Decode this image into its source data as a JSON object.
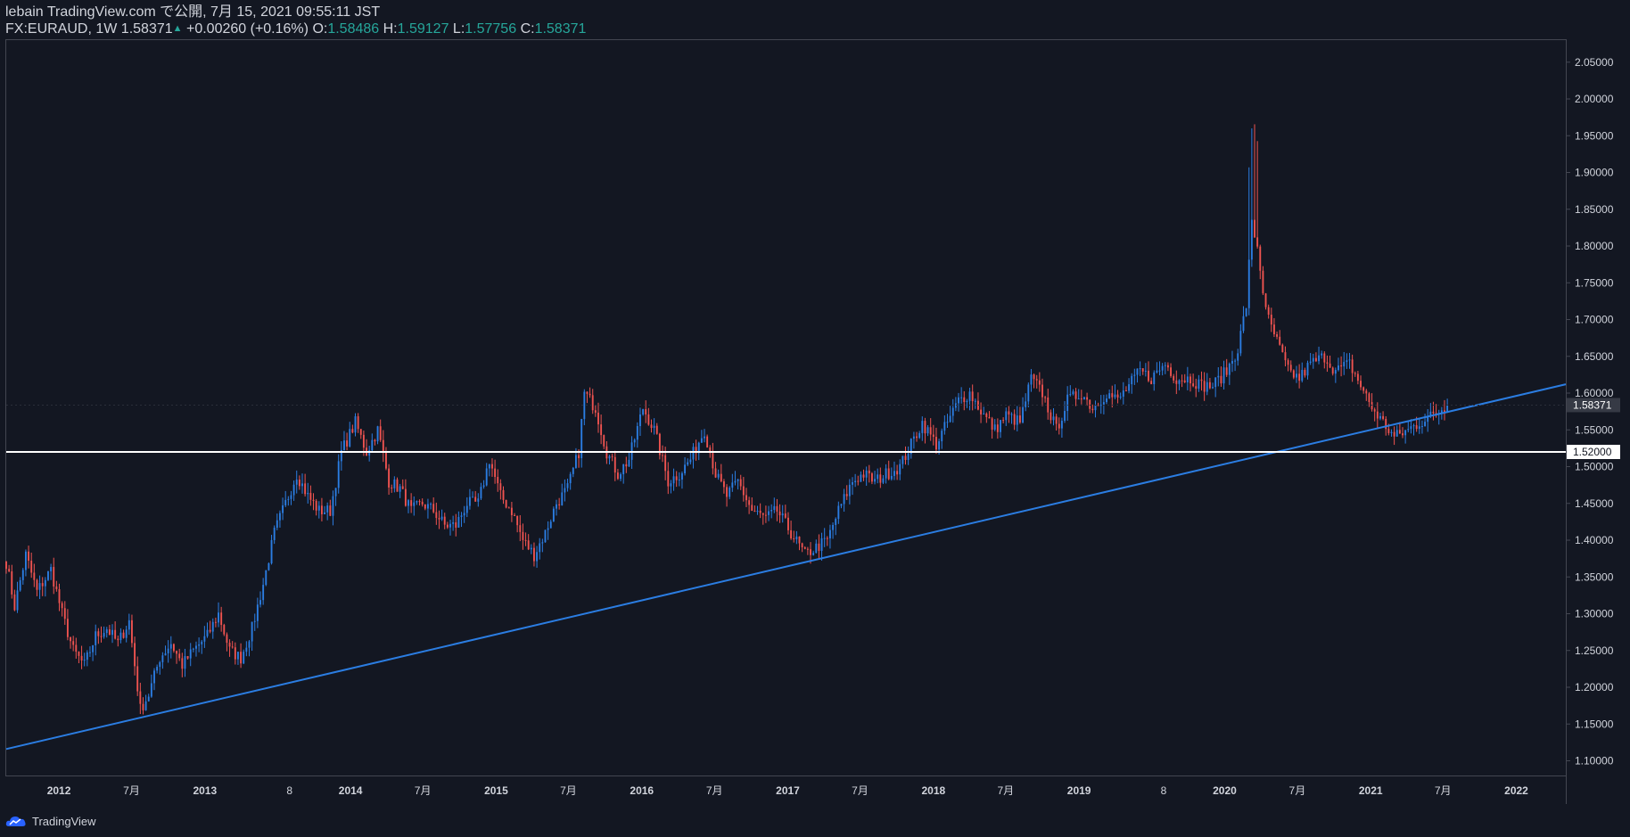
{
  "header": {
    "publish_line": "lebain TradingView.com で公開, 7月 15, 2021 09:55:11 JST",
    "symbol": "FX:EURAUD, 1W",
    "last": "1.58371",
    "change": "+0.00260 (+0.16%)",
    "open_label": "O:",
    "open": "1.58486",
    "high_label": "H:",
    "high": "1.59127",
    "low_label": "L:",
    "low": "1.57756",
    "close_label": "C:",
    "close": "1.58371"
  },
  "footer": {
    "brand": "TradingView",
    "icon": "tradingview-cloud-icon"
  },
  "colors": {
    "background": "#131722",
    "up": "#2b7de2",
    "down": "#ef5350",
    "trendline": "#2b7de2",
    "hline": "#ffffff",
    "axis_text": "#d1d4dc"
  },
  "chart_data": {
    "type": "candlestick",
    "ylim": [
      1.08,
      2.08
    ],
    "y_ticks": [
      "2.05000",
      "2.00000",
      "1.95000",
      "1.90000",
      "1.85000",
      "1.80000",
      "1.75000",
      "1.70000",
      "1.65000",
      "1.60000",
      "1.55000",
      "1.50000",
      "1.45000",
      "1.40000",
      "1.35000",
      "1.30000",
      "1.25000",
      "1.20000",
      "1.15000",
      "1.10000"
    ],
    "x_range": [
      "2011-08-22",
      "2022-05-05"
    ],
    "x_ticks": [
      {
        "label": "2012",
        "date": "2012-01-01"
      },
      {
        "label": "7月",
        "date": "2012-07-01"
      },
      {
        "label": "2013",
        "date": "2013-01-01"
      },
      {
        "label": "8",
        "date": "2013-08-01"
      },
      {
        "label": "2014",
        "date": "2014-01-01"
      },
      {
        "label": "7月",
        "date": "2014-07-01"
      },
      {
        "label": "2015",
        "date": "2015-01-01"
      },
      {
        "label": "7月",
        "date": "2015-07-01"
      },
      {
        "label": "2016",
        "date": "2016-01-01"
      },
      {
        "label": "7月",
        "date": "2016-07-01"
      },
      {
        "label": "2017",
        "date": "2017-01-01"
      },
      {
        "label": "7月",
        "date": "2017-07-01"
      },
      {
        "label": "2018",
        "date": "2018-01-01"
      },
      {
        "label": "7月",
        "date": "2018-07-01"
      },
      {
        "label": "2019",
        "date": "2019-01-01"
      },
      {
        "label": "8",
        "date": "2019-08-01"
      },
      {
        "label": "2020",
        "date": "2020-01-01"
      },
      {
        "label": "7月",
        "date": "2020-07-01"
      },
      {
        "label": "2021",
        "date": "2021-01-01"
      },
      {
        "label": "7月",
        "date": "2021-07-01"
      },
      {
        "label": "2022",
        "date": "2022-01-01"
      }
    ],
    "price_path": [
      [
        "2011-08-22",
        1.37
      ],
      [
        "2011-09-12",
        1.31
      ],
      [
        "2011-10-10",
        1.38
      ],
      [
        "2011-11-07",
        1.33
      ],
      [
        "2011-12-12",
        1.36
      ],
      [
        "2012-01-09",
        1.3
      ],
      [
        "2012-02-06",
        1.25
      ],
      [
        "2012-03-05",
        1.23
      ],
      [
        "2012-04-02",
        1.27
      ],
      [
        "2012-04-30",
        1.28
      ],
      [
        "2012-05-28",
        1.26
      ],
      [
        "2012-06-25",
        1.29
      ],
      [
        "2012-07-23",
        1.17
      ],
      [
        "2012-08-13",
        1.19
      ],
      [
        "2012-09-10",
        1.24
      ],
      [
        "2012-10-08",
        1.26
      ],
      [
        "2012-11-05",
        1.23
      ],
      [
        "2012-12-03",
        1.25
      ],
      [
        "2013-01-07",
        1.27
      ],
      [
        "2013-02-04",
        1.3
      ],
      [
        "2013-03-04",
        1.25
      ],
      [
        "2013-04-01",
        1.24
      ],
      [
        "2013-04-29",
        1.28
      ],
      [
        "2013-05-27",
        1.34
      ],
      [
        "2013-06-24",
        1.41
      ],
      [
        "2013-07-22",
        1.45
      ],
      [
        "2013-08-19",
        1.49
      ],
      [
        "2013-09-16",
        1.46
      ],
      [
        "2013-10-14",
        1.44
      ],
      [
        "2013-11-11",
        1.44
      ],
      [
        "2013-12-09",
        1.52
      ],
      [
        "2014-01-13",
        1.56
      ],
      [
        "2014-02-10",
        1.52
      ],
      [
        "2014-03-10",
        1.55
      ],
      [
        "2014-04-07",
        1.48
      ],
      [
        "2014-05-05",
        1.47
      ],
      [
        "2014-06-02",
        1.44
      ],
      [
        "2014-06-30",
        1.45
      ],
      [
        "2014-07-28",
        1.44
      ],
      [
        "2014-08-25",
        1.42
      ],
      [
        "2014-09-22",
        1.42
      ],
      [
        "2014-10-20",
        1.45
      ],
      [
        "2014-11-17",
        1.45
      ],
      [
        "2014-12-15",
        1.51
      ],
      [
        "2015-01-12",
        1.46
      ],
      [
        "2015-02-09",
        1.44
      ],
      [
        "2015-03-09",
        1.4
      ],
      [
        "2015-04-06",
        1.38
      ],
      [
        "2015-05-04",
        1.41
      ],
      [
        "2015-06-01",
        1.45
      ],
      [
        "2015-06-29",
        1.47
      ],
      [
        "2015-07-27",
        1.52
      ],
      [
        "2015-08-10",
        1.6
      ],
      [
        "2015-09-07",
        1.58
      ],
      [
        "2015-10-05",
        1.52
      ],
      [
        "2015-11-02",
        1.49
      ],
      [
        "2015-11-30",
        1.51
      ],
      [
        "2016-01-04",
        1.58
      ],
      [
        "2016-02-01",
        1.55
      ],
      [
        "2016-03-07",
        1.48
      ],
      [
        "2016-04-04",
        1.49
      ],
      [
        "2016-05-02",
        1.51
      ],
      [
        "2016-06-06",
        1.55
      ],
      [
        "2016-07-04",
        1.49
      ],
      [
        "2016-08-01",
        1.46
      ],
      [
        "2016-08-29",
        1.48
      ],
      [
        "2016-10-03",
        1.44
      ],
      [
        "2016-11-07",
        1.43
      ],
      [
        "2016-12-05",
        1.44
      ],
      [
        "2017-01-09",
        1.41
      ],
      [
        "2017-02-13",
        1.38
      ],
      [
        "2017-03-13",
        1.39
      ],
      [
        "2017-04-10",
        1.4
      ],
      [
        "2017-05-08",
        1.44
      ],
      [
        "2017-06-12",
        1.48
      ],
      [
        "2017-07-10",
        1.49
      ],
      [
        "2017-08-07",
        1.48
      ],
      [
        "2017-09-04",
        1.49
      ],
      [
        "2017-10-09",
        1.5
      ],
      [
        "2017-11-06",
        1.53
      ],
      [
        "2017-12-04",
        1.56
      ],
      [
        "2018-01-08",
        1.53
      ],
      [
        "2018-02-05",
        1.56
      ],
      [
        "2018-03-05",
        1.59
      ],
      [
        "2018-04-02",
        1.6
      ],
      [
        "2018-05-07",
        1.57
      ],
      [
        "2018-06-04",
        1.55
      ],
      [
        "2018-07-02",
        1.57
      ],
      [
        "2018-08-06",
        1.56
      ],
      [
        "2018-09-03",
        1.62
      ],
      [
        "2018-10-01",
        1.6
      ],
      [
        "2018-11-05",
        1.55
      ],
      [
        "2018-12-03",
        1.59
      ],
      [
        "2019-01-07",
        1.6
      ],
      [
        "2019-02-04",
        1.58
      ],
      [
        "2019-03-11",
        1.6
      ],
      [
        "2019-04-08",
        1.59
      ],
      [
        "2019-05-06",
        1.61
      ],
      [
        "2019-06-03",
        1.63
      ],
      [
        "2019-07-01",
        1.62
      ],
      [
        "2019-08-05",
        1.64
      ],
      [
        "2019-09-02",
        1.62
      ],
      [
        "2019-10-07",
        1.62
      ],
      [
        "2019-11-04",
        1.61
      ],
      [
        "2019-12-02",
        1.61
      ],
      [
        "2020-01-06",
        1.63
      ],
      [
        "2020-02-03",
        1.66
      ],
      [
        "2020-02-24",
        1.72
      ],
      [
        "2020-03-09",
        1.83
      ],
      [
        "2020-03-23",
        1.8
      ],
      [
        "2020-04-13",
        1.71
      ],
      [
        "2020-05-11",
        1.67
      ],
      [
        "2020-06-08",
        1.63
      ],
      [
        "2020-07-06",
        1.62
      ],
      [
        "2020-08-03",
        1.64
      ],
      [
        "2020-09-07",
        1.65
      ],
      [
        "2020-10-05",
        1.63
      ],
      [
        "2020-11-09",
        1.64
      ],
      [
        "2020-12-07",
        1.61
      ],
      [
        "2021-01-04",
        1.58
      ],
      [
        "2021-02-01",
        1.56
      ],
      [
        "2021-03-01",
        1.54
      ],
      [
        "2021-04-05",
        1.55
      ],
      [
        "2021-05-03",
        1.56
      ],
      [
        "2021-06-07",
        1.57
      ],
      [
        "2021-07-12",
        1.584
      ]
    ],
    "trendline": {
      "x1": "2011-08-22",
      "y1": 1.116,
      "x2": "2022-05-05",
      "y2": 1.612
    },
    "horizontal_line": {
      "y": 1.52,
      "label": "1.52000"
    },
    "last_price": {
      "y": 1.58371,
      "label": "1.58371"
    }
  }
}
